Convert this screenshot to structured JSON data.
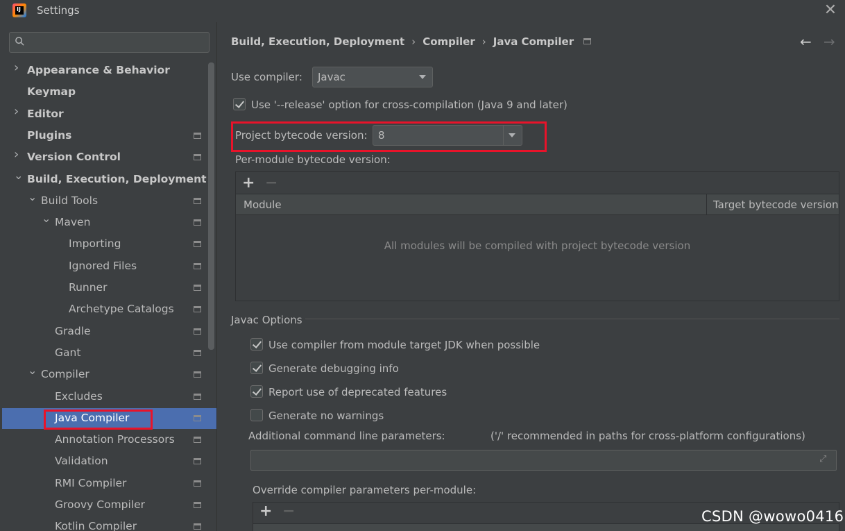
{
  "window": {
    "title": "Settings",
    "close_glyph": "✕",
    "logo_text": "IJ"
  },
  "sidebar": {
    "search": {
      "placeholder": "",
      "value": ""
    },
    "items": [
      {
        "label": "Appearance & Behavior",
        "bold": true,
        "arrow": "›",
        "proj_icon": false
      },
      {
        "label": "Keymap",
        "bold": true,
        "arrow": "",
        "proj_icon": false
      },
      {
        "label": "Editor",
        "bold": true,
        "arrow": "›",
        "proj_icon": false
      },
      {
        "label": "Plugins",
        "bold": true,
        "arrow": "",
        "proj_icon": true
      },
      {
        "label": "Version Control",
        "bold": true,
        "arrow": "›",
        "proj_icon": true
      },
      {
        "label": "Build, Execution, Deployment",
        "bold": true,
        "arrow": "⌄",
        "proj_icon": false
      },
      {
        "label": "Build Tools",
        "bold": false,
        "arrow": "⌄",
        "proj_icon": true
      },
      {
        "label": "Maven",
        "bold": false,
        "arrow": "⌄",
        "proj_icon": true
      },
      {
        "label": "Importing",
        "bold": false,
        "arrow": "",
        "proj_icon": true
      },
      {
        "label": "Ignored Files",
        "bold": false,
        "arrow": "",
        "proj_icon": true
      },
      {
        "label": "Runner",
        "bold": false,
        "arrow": "",
        "proj_icon": true
      },
      {
        "label": "Archetype Catalogs",
        "bold": false,
        "arrow": "",
        "proj_icon": true
      },
      {
        "label": "Gradle",
        "bold": false,
        "arrow": "",
        "proj_icon": true
      },
      {
        "label": "Gant",
        "bold": false,
        "arrow": "",
        "proj_icon": true
      },
      {
        "label": "Compiler",
        "bold": false,
        "arrow": "⌄",
        "proj_icon": true
      },
      {
        "label": "Excludes",
        "bold": false,
        "arrow": "",
        "proj_icon": true
      },
      {
        "label": "Java Compiler",
        "bold": false,
        "arrow": "",
        "proj_icon": true,
        "selected": true
      },
      {
        "label": "Annotation Processors",
        "bold": false,
        "arrow": "",
        "proj_icon": true
      },
      {
        "label": "Validation",
        "bold": false,
        "arrow": "",
        "proj_icon": true
      },
      {
        "label": "RMI Compiler",
        "bold": false,
        "arrow": "",
        "proj_icon": true
      },
      {
        "label": "Groovy Compiler",
        "bold": false,
        "arrow": "",
        "proj_icon": true
      },
      {
        "label": "Kotlin Compiler",
        "bold": false,
        "arrow": "",
        "proj_icon": true
      }
    ]
  },
  "breadcrumb": {
    "items": [
      "Build, Execution, Deployment",
      "Compiler",
      "Java Compiler"
    ],
    "separator": "›",
    "back_glyph": "←",
    "forward_glyph": "→"
  },
  "main": {
    "use_compiler_label": "Use compiler:",
    "use_compiler_value": "Javac",
    "release_option_label": "Use '--release' option for cross-compilation (Java 9 and later)",
    "release_option_checked": true,
    "bytecode_label": "Project bytecode version:",
    "bytecode_value": "8",
    "per_module_label": "Per-module bytecode version:",
    "module_table": {
      "add": "+",
      "remove": "−",
      "columns": [
        "Module",
        "Target bytecode version"
      ],
      "empty_text": "All modules will be compiled with project bytecode version"
    },
    "javac_options_title": "Javac Options",
    "options": [
      {
        "label": "Use compiler from module target JDK when possible",
        "checked": true
      },
      {
        "label": "Generate debugging info",
        "checked": true
      },
      {
        "label": "Report use of deprecated features",
        "checked": true
      },
      {
        "label": "Generate no warnings",
        "checked": false
      }
    ],
    "additional_params_label": "Additional command line parameters:",
    "additional_params_hint": "('/' recommended in paths for cross-platform configurations)",
    "additional_params_value": "",
    "expand_glyph": "⤢",
    "override_label": "Override compiler parameters per-module:",
    "override_add": "+",
    "override_remove": "−"
  },
  "watermark": "CSDN @wowo0416",
  "colors": {
    "background": "#3c3f41",
    "selection": "#4b6eaf",
    "highlight_box": "#e8132a"
  }
}
